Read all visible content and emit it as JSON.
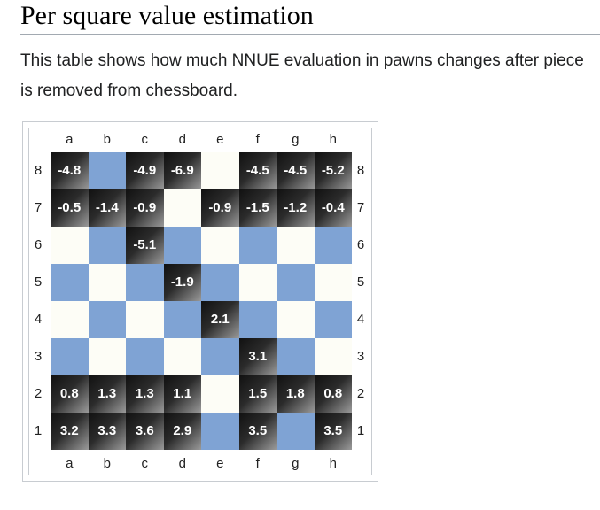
{
  "heading": "Per square value estimation",
  "intro": "This table shows how much NNUE evaluation in pawns changes after piece is removed from chessboard.",
  "board": {
    "files": [
      "a",
      "b",
      "c",
      "d",
      "e",
      "f",
      "g",
      "h"
    ],
    "ranks": [
      "8",
      "7",
      "6",
      "5",
      "4",
      "3",
      "2",
      "1"
    ],
    "colors": {
      "light_square": "#fdfdf6",
      "dark_square": "#7fa3d4",
      "value_square": "#1a1a1a",
      "value_text": "#ffffff"
    },
    "values": [
      [
        "-4.8",
        "",
        "-4.9",
        "-6.9",
        "",
        "-4.5",
        "-4.5",
        "-5.2"
      ],
      [
        "-0.5",
        "-1.4",
        "-0.9",
        "",
        "-0.9",
        "-1.5",
        "-1.2",
        "-0.4"
      ],
      [
        "",
        "",
        "-5.1",
        "",
        "",
        "",
        "",
        ""
      ],
      [
        "",
        "",
        "",
        "-1.9",
        "",
        "",
        "",
        ""
      ],
      [
        "",
        "",
        "",
        "",
        "2.1",
        "",
        "",
        ""
      ],
      [
        "",
        "",
        "",
        "",
        "",
        "3.1",
        "",
        ""
      ],
      [
        "0.8",
        "1.3",
        "1.3",
        "1.1",
        "",
        "1.5",
        "1.8",
        "0.8"
      ],
      [
        "3.2",
        "3.3",
        "3.6",
        "2.9",
        "",
        "3.5",
        "",
        "3.5"
      ]
    ]
  }
}
